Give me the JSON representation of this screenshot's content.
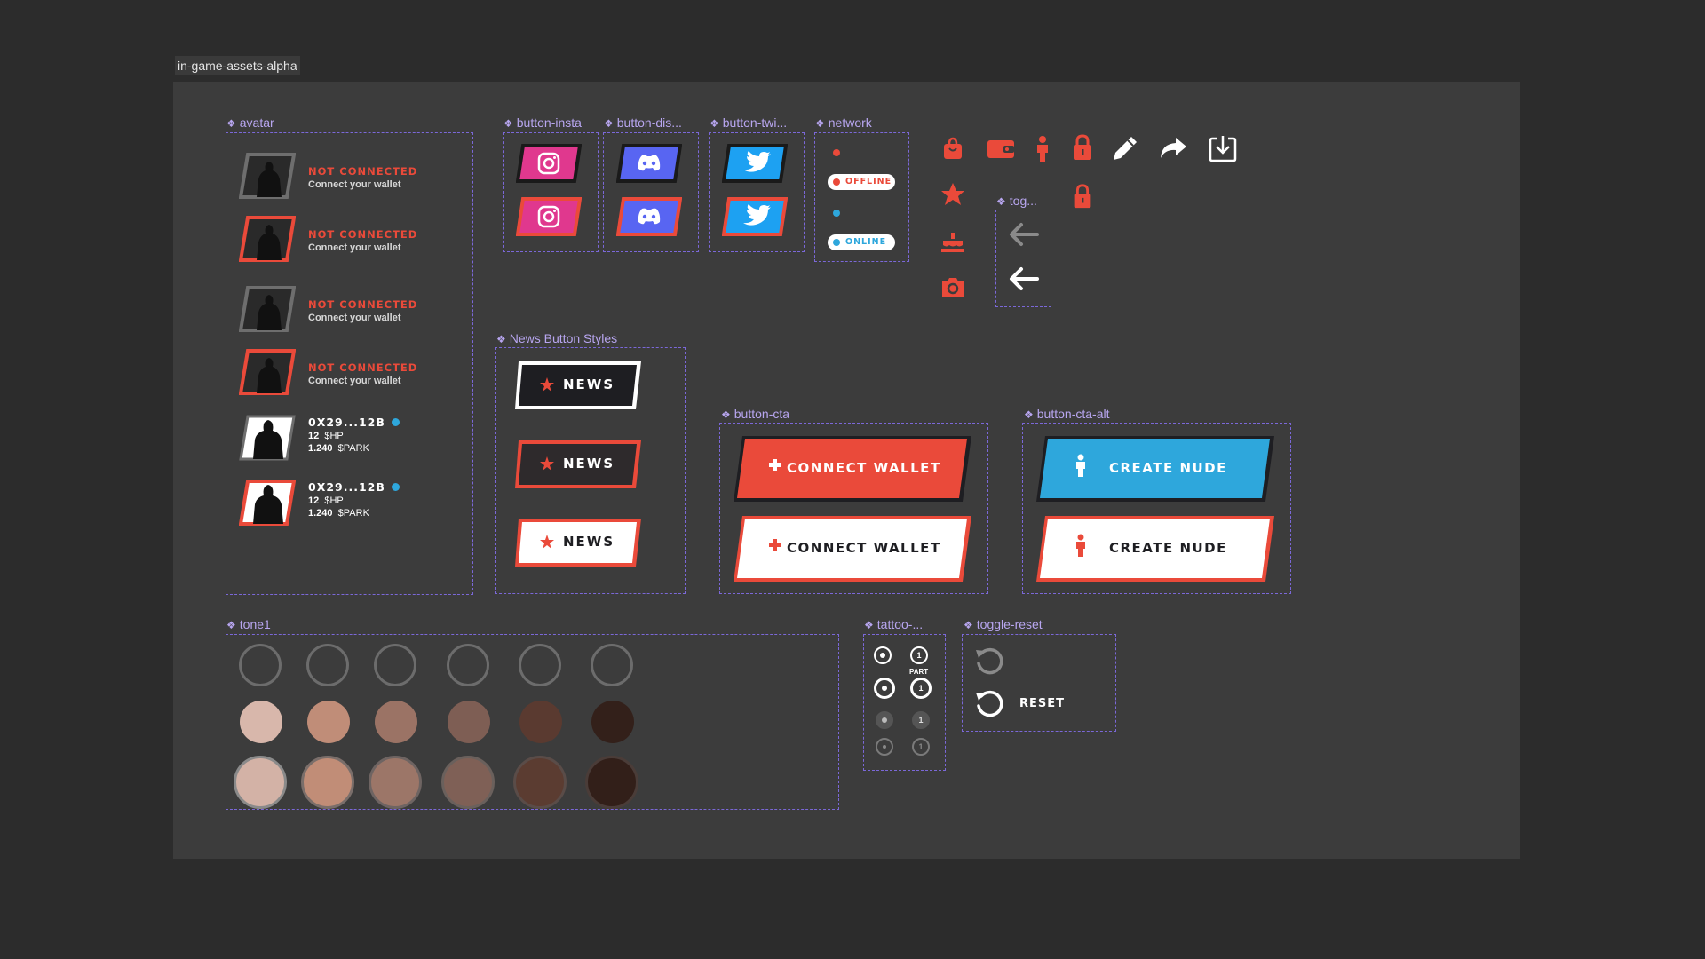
{
  "frame_title": "in-game-assets-alpha",
  "components": {
    "avatar": "avatar",
    "insta": "button-insta",
    "discord": "button-dis...",
    "twitter": "button-twi...",
    "network": "network",
    "toggle": "tog...",
    "news": "News Button Styles",
    "cta": "button-cta",
    "cta_alt": "button-cta-alt",
    "tone": "tone1",
    "tattoo": "tattoo-...",
    "toggle_reset": "toggle-reset"
  },
  "avatar": {
    "not_connected": "NOT CONNECTED",
    "connect_hint": "Connect your wallet",
    "address": "0X29...12B",
    "hp_value": "12",
    "hp_unit": "$HP",
    "spark_value": "1.240",
    "spark_unit": "$PARK"
  },
  "network": {
    "offline": "OFFLINE",
    "online": "ONLINE"
  },
  "news": {
    "label": "NEWS"
  },
  "cta": {
    "label": "CONNECT WALLET"
  },
  "cta_alt": {
    "label": "CREATE NUDE"
  },
  "tattoo": {
    "part_label": "PART",
    "num": "1"
  },
  "toggle_reset": {
    "label": "RESET"
  },
  "colors": {
    "accent_red": "#ea4a3a",
    "accent_blue": "#2ea7dc",
    "instagram": "#e0388e",
    "discord": "#5865f2",
    "twitter": "#1da1f2",
    "component_outline": "#7b68d8"
  },
  "tones": {
    "row2": [
      "#d8b7ab",
      "#c08d78",
      "#9b7365",
      "#7e5e54",
      "#5a3a30",
      "#33201a"
    ],
    "row3": [
      "#d3b2a6",
      "#c18d77",
      "#9c7668",
      "#7f6056",
      "#5b3c31",
      "#321f19"
    ]
  },
  "icons": [
    "bag-icon",
    "wallet-icon",
    "person-icon",
    "lock-icon",
    "pencil-icon",
    "share-icon",
    "download-icon",
    "star-icon",
    "lock-icon",
    "cake-icon",
    "camera-icon",
    "arrow-left-icon",
    "reset-icon"
  ]
}
